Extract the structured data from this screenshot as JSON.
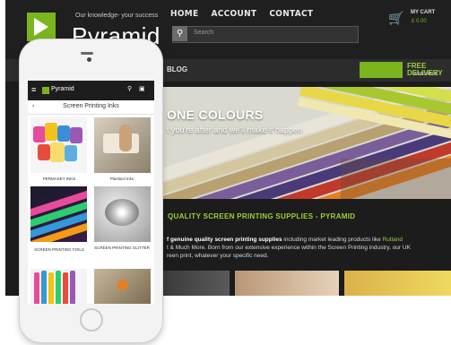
{
  "desktop": {
    "tagline": "Our knowledge- your success",
    "brand": "Pyramid",
    "nav": [
      "HOME",
      "ACCOUNT",
      "CONTACT"
    ],
    "search_placeholder": "Search",
    "cart": {
      "title": "MY CART",
      "amount": "£ 0.00"
    },
    "subnav": [
      "BLOG"
    ],
    "delivery": {
      "title": "FREE DELIVERY",
      "sub": "- AVAILABLE -"
    },
    "hero": {
      "title": "ONE COLOURS",
      "subtitle": "t you're after and we'll make it happen"
    },
    "section_title": "QUALITY SCREEN PRINTING SUPPLIES - PYRAMID",
    "paragraph": {
      "lead": "f genuine quality screen printing supplies",
      "mid": " including market leading products like ",
      "link": "Rutland",
      "line2": "t & Much More. Born from our extensive experience within the Screen Printing industry, our UK",
      "line3": "reen print, whatever your specific need."
    }
  },
  "phone": {
    "brand": "Pyramid",
    "page_title": "Screen Printing Inks",
    "back": "‹",
    "tiles": [
      {
        "caption": "PERMASET INKS"
      },
      {
        "caption": "Plastisol Inks"
      },
      {
        "caption": "SCREEN PRINTING FOILS"
      },
      {
        "caption": "SCREEN PRINTING GLITTER"
      }
    ]
  },
  "colors": {
    "accent": "#7ab51d",
    "bg": "#1c1c1c"
  }
}
